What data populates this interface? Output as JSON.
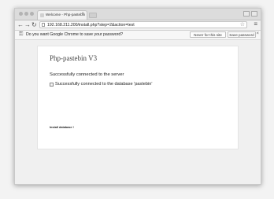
{
  "browser": {
    "tab_title": "Welcome - Php-pastebin",
    "tab_close": "×",
    "url": "192.168.211.200/install.php?step=2&action=test",
    "star": "☆",
    "menu": "≡",
    "nav": {
      "back": "←",
      "forward": "→",
      "reload": "↻"
    }
  },
  "infobar": {
    "message": "Do you want Google Chrome to save your password?",
    "never_label": "Never for this site",
    "save_label": "Save password",
    "close": "×"
  },
  "page": {
    "title": "Php-pastebin V3",
    "server_message": "Successfully connected to the server",
    "db_message": "Successfully connected to the database 'pastebin'",
    "install_link": "Install database !"
  }
}
